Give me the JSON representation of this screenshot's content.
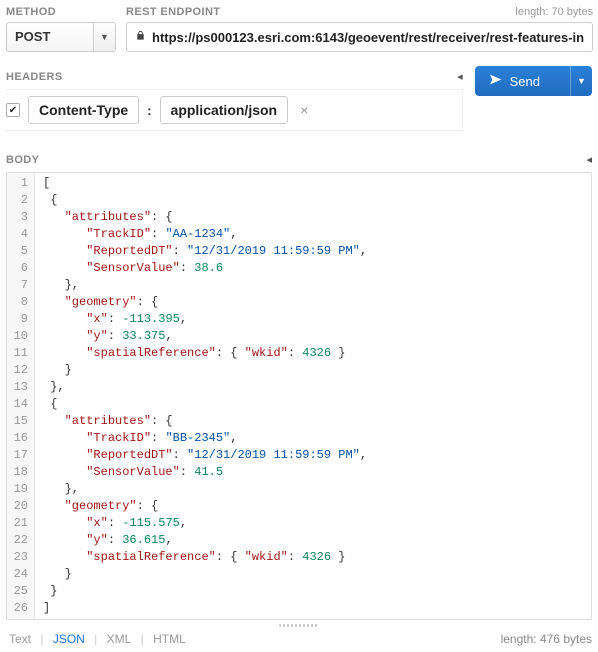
{
  "method": {
    "label": "METHOD",
    "value": "POST"
  },
  "endpoint": {
    "label": "REST ENDPOINT",
    "url": "https://ps000123.esri.com:6143/geoevent/rest/receiver/rest-features-in",
    "length_hint": "length: 70 bytes"
  },
  "headers": {
    "label": "HEADERS",
    "item": {
      "name": "Content-Type",
      "value": "application/json",
      "checked": true
    }
  },
  "send": {
    "label": "Send"
  },
  "body": {
    "label": "BODY",
    "length_hint": "length: 476 bytes",
    "lines": [
      [
        {
          "t": "[",
          "c": "punc"
        }
      ],
      [
        {
          "t": " {",
          "c": "punc"
        }
      ],
      [
        {
          "t": "   ",
          "c": "punc"
        },
        {
          "t": "\"attributes\"",
          "c": "key"
        },
        {
          "t": ": {",
          "c": "punc"
        }
      ],
      [
        {
          "t": "      ",
          "c": "punc"
        },
        {
          "t": "\"TrackID\"",
          "c": "key"
        },
        {
          "t": ": ",
          "c": "punc"
        },
        {
          "t": "\"AA-1234\"",
          "c": "str"
        },
        {
          "t": ",",
          "c": "punc"
        }
      ],
      [
        {
          "t": "      ",
          "c": "punc"
        },
        {
          "t": "\"ReportedDT\"",
          "c": "key"
        },
        {
          "t": ": ",
          "c": "punc"
        },
        {
          "t": "\"12/31/2019 11:59:59 PM\"",
          "c": "str"
        },
        {
          "t": ",",
          "c": "punc"
        }
      ],
      [
        {
          "t": "      ",
          "c": "punc"
        },
        {
          "t": "\"SensorValue\"",
          "c": "key"
        },
        {
          "t": ": ",
          "c": "punc"
        },
        {
          "t": "38.6",
          "c": "num"
        }
      ],
      [
        {
          "t": "   },",
          "c": "punc"
        }
      ],
      [
        {
          "t": "   ",
          "c": "punc"
        },
        {
          "t": "\"geometry\"",
          "c": "key"
        },
        {
          "t": ": {",
          "c": "punc"
        }
      ],
      [
        {
          "t": "      ",
          "c": "punc"
        },
        {
          "t": "\"x\"",
          "c": "key"
        },
        {
          "t": ": ",
          "c": "punc"
        },
        {
          "t": "-113.395",
          "c": "num"
        },
        {
          "t": ",",
          "c": "punc"
        }
      ],
      [
        {
          "t": "      ",
          "c": "punc"
        },
        {
          "t": "\"y\"",
          "c": "key"
        },
        {
          "t": ": ",
          "c": "punc"
        },
        {
          "t": "33.375",
          "c": "num"
        },
        {
          "t": ",",
          "c": "punc"
        }
      ],
      [
        {
          "t": "      ",
          "c": "punc"
        },
        {
          "t": "\"spatialReference\"",
          "c": "key"
        },
        {
          "t": ": { ",
          "c": "punc"
        },
        {
          "t": "\"wkid\"",
          "c": "key"
        },
        {
          "t": ": ",
          "c": "punc"
        },
        {
          "t": "4326",
          "c": "num"
        },
        {
          "t": " }",
          "c": "punc"
        }
      ],
      [
        {
          "t": "   }",
          "c": "punc"
        }
      ],
      [
        {
          "t": " },",
          "c": "punc"
        }
      ],
      [
        {
          "t": " {",
          "c": "punc"
        }
      ],
      [
        {
          "t": "   ",
          "c": "punc"
        },
        {
          "t": "\"attributes\"",
          "c": "key"
        },
        {
          "t": ": {",
          "c": "punc"
        }
      ],
      [
        {
          "t": "      ",
          "c": "punc"
        },
        {
          "t": "\"TrackID\"",
          "c": "key"
        },
        {
          "t": ": ",
          "c": "punc"
        },
        {
          "t": "\"BB-2345\"",
          "c": "str"
        },
        {
          "t": ",",
          "c": "punc"
        }
      ],
      [
        {
          "t": "      ",
          "c": "punc"
        },
        {
          "t": "\"ReportedDT\"",
          "c": "key"
        },
        {
          "t": ": ",
          "c": "punc"
        },
        {
          "t": "\"12/31/2019 11:59:59 PM\"",
          "c": "str"
        },
        {
          "t": ",",
          "c": "punc"
        }
      ],
      [
        {
          "t": "      ",
          "c": "punc"
        },
        {
          "t": "\"SensorValue\"",
          "c": "key"
        },
        {
          "t": ": ",
          "c": "punc"
        },
        {
          "t": "41.5",
          "c": "num"
        }
      ],
      [
        {
          "t": "   },",
          "c": "punc"
        }
      ],
      [
        {
          "t": "   ",
          "c": "punc"
        },
        {
          "t": "\"geometry\"",
          "c": "key"
        },
        {
          "t": ": {",
          "c": "punc"
        }
      ],
      [
        {
          "t": "      ",
          "c": "punc"
        },
        {
          "t": "\"x\"",
          "c": "key"
        },
        {
          "t": ": ",
          "c": "punc"
        },
        {
          "t": "-115.575",
          "c": "num"
        },
        {
          "t": ",",
          "c": "punc"
        }
      ],
      [
        {
          "t": "      ",
          "c": "punc"
        },
        {
          "t": "\"y\"",
          "c": "key"
        },
        {
          "t": ": ",
          "c": "punc"
        },
        {
          "t": "36.615",
          "c": "num"
        },
        {
          "t": ",",
          "c": "punc"
        }
      ],
      [
        {
          "t": "      ",
          "c": "punc"
        },
        {
          "t": "\"spatialReference\"",
          "c": "key"
        },
        {
          "t": ": { ",
          "c": "punc"
        },
        {
          "t": "\"wkid\"",
          "c": "key"
        },
        {
          "t": ": ",
          "c": "punc"
        },
        {
          "t": "4326",
          "c": "num"
        },
        {
          "t": " }",
          "c": "punc"
        }
      ],
      [
        {
          "t": "   }",
          "c": "punc"
        }
      ],
      [
        {
          "t": " }",
          "c": "punc"
        }
      ],
      [
        {
          "t": "]",
          "c": "punc"
        }
      ]
    ]
  },
  "formats": {
    "items": [
      "Text",
      "JSON",
      "XML",
      "HTML"
    ],
    "active": "JSON"
  }
}
